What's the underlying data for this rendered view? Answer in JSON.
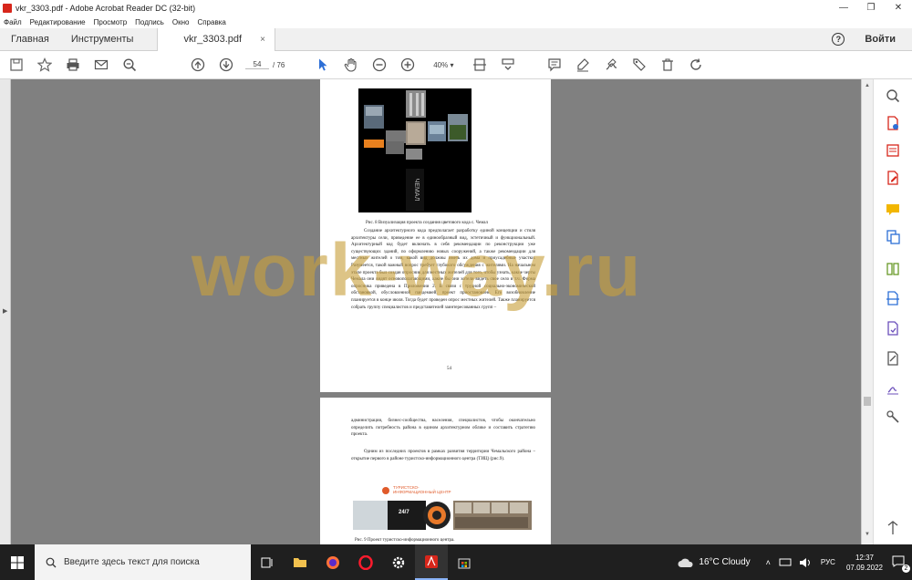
{
  "window": {
    "title": "vkr_3303.pdf - Adobe Acrobat Reader DC (32-bit)",
    "minimize": "—",
    "maximize": "❐",
    "close": "✕"
  },
  "menu": [
    "Файл",
    "Редактирование",
    "Просмотр",
    "Подпись",
    "Окно",
    "Справка"
  ],
  "tabs": {
    "home": "Главная",
    "tools": "Инструменты",
    "doc": "vkr_3303.pdf",
    "close": "×",
    "signin": "Войти",
    "help": "?"
  },
  "toolbar": {
    "page_current": "54",
    "page_sep": "/",
    "page_total": "76",
    "zoom": "40%"
  },
  "doc": {
    "fig8_caption": "Рис. 8 Визуализация проекта создания цветового кода с. Чемал",
    "page54_text": "Создание архитектурного кода предполагает разработку единой концепции и стиля архитектуры сели, приведение ее в единообразный вид, эстетичный и функциональный. Архитектурный код будет включать в себя рекомендации по реконструкции уже существующих зданий, по оформлению новых сооружений, а также рекомендации для местных жителей о том, какой вид должны иметь их дома и приусадебные участки. Разумеется, такой важный вопрос требует глубокого обсуждения с жителями. На начальном этапе проекта был создан опросник для местных жителей для того, чтобы узнать, какие черты Чемала они видят основополагающими, какие бы они хотели видеть свое село в т.ч. Форма опросника приведена в Приложении 2. В связи с трудной социально-экономической обстановкой, обусловленной пандемией, проект приостановлен. Его возобновление планируется в конце июля. Тогда будет проведен опрос местных жителей. Также планируется собрать группу специалистов и представителей заинтересованных групп –",
    "page54_number": "54",
    "page55_text1": "администрации, бизнес-сообщества, населения, специалистов, чтобы окончательно определить потребность района в едином архитектурном облике и составить стратегию проекта.",
    "page55_text2": "Одним из последних проектов в рамках развития территории Чемальского района – открытие первого в районе туристско-информационного центра (ТИЦ) (рис.9).",
    "fig9_title_line1": "ТУРИСТСКО-",
    "fig9_title_line2": "ИНФОРМАЦИОННЫЙ ЦЕНТР",
    "fig9_label": "24/7",
    "fig8_vertical": "ЧЕМАЛ",
    "fig9_caption": "Рис. 9 Проект туристско-информационного центра."
  },
  "watermark": "work-way.ru",
  "taskbar": {
    "search_placeholder": "Введите здесь текст для поиска",
    "weather": "16°C  Cloudy",
    "lang": "РУС",
    "time": "12:37",
    "date": "07.09.2022",
    "badge": "2"
  },
  "colors": {
    "acrobat_red": "#d7261b",
    "toolbar_blue": "#2d6fd6",
    "taskbar_bg": "#1f1f1f"
  }
}
